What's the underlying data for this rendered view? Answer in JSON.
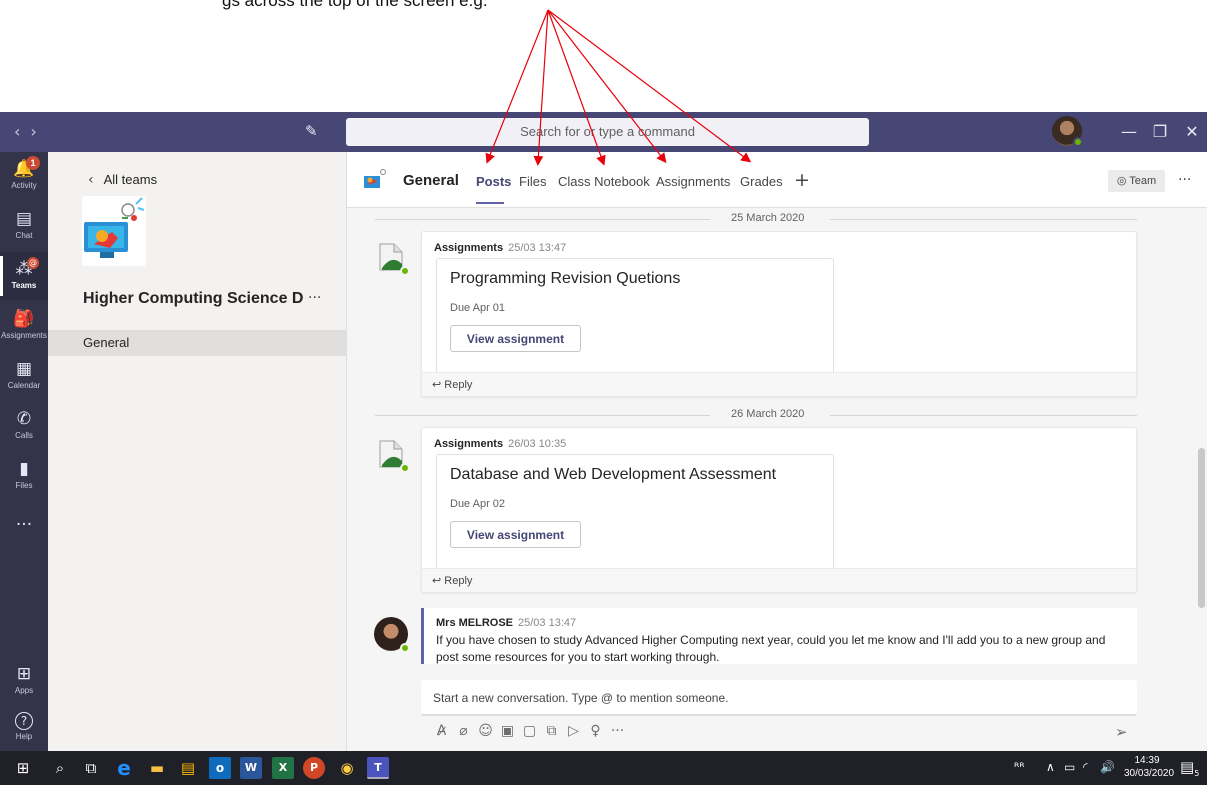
{
  "annotation": {
    "text": "gs across the top of the screen e.g."
  },
  "titlebar": {
    "back_arrow": "‹",
    "forward_arrow": "›",
    "search_placeholder": "Search for or type a command",
    "minimize": "—",
    "restore": "❐",
    "close": "✕"
  },
  "rail": {
    "items": [
      {
        "label": "Activity",
        "glyph": "🔔",
        "badge": "1"
      },
      {
        "label": "Chat",
        "glyph": "▤"
      },
      {
        "label": "Teams",
        "glyph": "⁂",
        "badge": "@"
      },
      {
        "label": "Assignments",
        "glyph": "🎒"
      },
      {
        "label": "Calendar",
        "glyph": "▦"
      },
      {
        "label": "Calls",
        "glyph": "✆"
      },
      {
        "label": "Files",
        "glyph": "▮"
      },
      {
        "label": "",
        "glyph": "···"
      },
      {
        "label": "Apps",
        "glyph": "⊞"
      },
      {
        "label": "Help",
        "glyph": "?"
      }
    ]
  },
  "teampanel": {
    "all_teams": "All teams",
    "chevron": "‹",
    "team_name": "Higher Computing Science D",
    "more": "···",
    "channel": "General"
  },
  "channel": {
    "name": "General",
    "tabs": [
      "Posts",
      "Files",
      "Class Notebook",
      "Assignments",
      "Grades"
    ],
    "active_tab": "Posts",
    "add_tab": "+",
    "team_button": "◎ Team",
    "more": "···"
  },
  "feed": {
    "dates": [
      "25 March 2020",
      "26 March 2020"
    ],
    "posts": [
      {
        "author": "Assignments",
        "time": "25/03 13:47",
        "title": "Programming Revision Quetions",
        "due": "Due Apr 01",
        "button": "View assignment",
        "reply": "↩ Reply"
      },
      {
        "author": "Assignments",
        "time": "26/03 10:35",
        "title": "Database and Web Development Assessment",
        "due": "Due Apr 02",
        "button": "View assignment",
        "reply": "↩ Reply"
      }
    ],
    "message": {
      "author": "Mrs MELROSE",
      "time": "25/03 13:47",
      "body": "If you have chosen to study Advanced Higher Computing next year, could you let me know and I'll add you to a new group and post some resources for you to start working through."
    }
  },
  "compose": {
    "placeholder": "Start a new conversation. Type @ to mention someone.",
    "tools": [
      "A̷",
      "⌀",
      "☺",
      "▣",
      "▢",
      "⧉",
      "▷",
      "♀",
      "···"
    ],
    "send": "➢"
  },
  "taskbar": {
    "icons": [
      "⊞",
      "⌕",
      "⧉",
      "e",
      "▬",
      "▤",
      "o",
      "W",
      "X",
      "P",
      "◉",
      "T"
    ],
    "tray": [
      "ᴿᴿ",
      "∧",
      "▭",
      "◜",
      "🔊"
    ],
    "time": "14:39",
    "date": "30/03/2020",
    "notification_count": "5"
  },
  "colors": {
    "titlebar": "#464775",
    "rail": "#33344a",
    "accent": "#6264a7",
    "annotation_arrow": "#e8000b",
    "presence": "#6bb700",
    "badge": "#cc4a31"
  }
}
